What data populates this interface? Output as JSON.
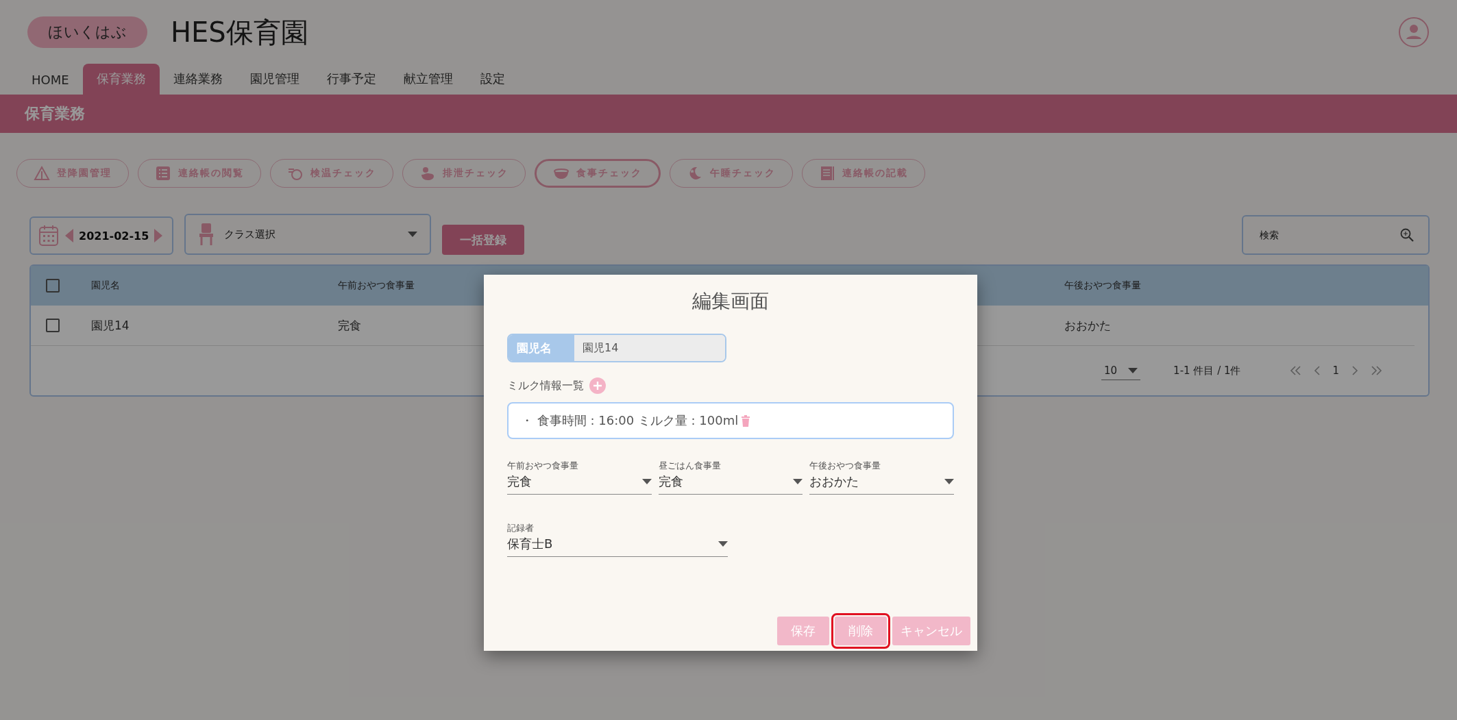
{
  "header": {
    "logo": "ほいくはぶ",
    "title": "HES保育園"
  },
  "nav": [
    {
      "label": "HOME",
      "selected": false
    },
    {
      "label": "保育業務",
      "selected": true
    },
    {
      "label": "連絡業務",
      "selected": false
    },
    {
      "label": "園児管理",
      "selected": false
    },
    {
      "label": "行事予定",
      "selected": false
    },
    {
      "label": "献立管理",
      "selected": false
    },
    {
      "label": "設定",
      "selected": false
    }
  ],
  "section_title": "保育業務",
  "function_buttons": [
    {
      "label": "登降園管理",
      "selected": false
    },
    {
      "label": "連絡帳の閲覧",
      "selected": false
    },
    {
      "label": "検温チェック",
      "selected": false
    },
    {
      "label": "排泄チェック",
      "selected": false
    },
    {
      "label": "食事チェック",
      "selected": true
    },
    {
      "label": "午睡チェック",
      "selected": false
    },
    {
      "label": "連絡帳の記載",
      "selected": false
    }
  ],
  "toolbar": {
    "date": "2021-02-15",
    "class_select": "クラス選択",
    "bulk_button": "一括登録",
    "search_placeholder": "検索"
  },
  "table": {
    "header_checked": false,
    "columns": [
      "園児名",
      "午前おやつ食事量",
      "午後おやつ食事量"
    ],
    "rows": [
      {
        "checked": false,
        "cells": [
          "園児14",
          "完食",
          "おおかた"
        ]
      }
    ],
    "pagination": {
      "page_size": "10",
      "range": "1-1 件目 / 1件",
      "page": "1"
    }
  },
  "modal": {
    "title": "編集画面",
    "name_label": "園児名",
    "name_value": "園児14",
    "milk_label": "ミルク情報一覧",
    "milk_items": [
      "・ 食事時間 : 16:00 ミルク量 : 100ml"
    ],
    "selects": [
      {
        "label": "午前おやつ食事量",
        "value": "完食"
      },
      {
        "label": "昼ごはん食事量",
        "value": "完食"
      },
      {
        "label": "午後おやつ食事量",
        "value": "おおかた"
      }
    ],
    "recorder": {
      "label": "記録者",
      "value": "保育士B"
    },
    "buttons": [
      {
        "label": "保存",
        "highlighted": false
      },
      {
        "label": "削除",
        "highlighted": true
      },
      {
        "label": "キャンセル",
        "highlighted": false
      }
    ]
  }
}
